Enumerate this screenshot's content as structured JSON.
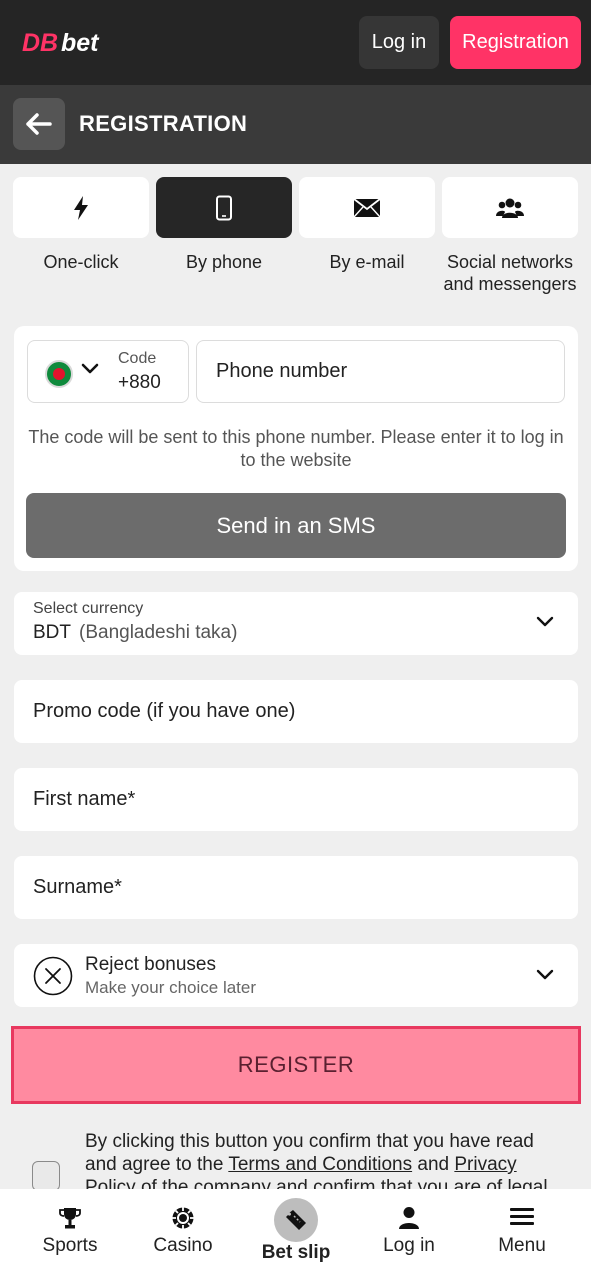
{
  "header": {
    "logo_text": "DBbet",
    "login_label": "Log in",
    "register_label": "Registration"
  },
  "titlebar": {
    "title": "REGISTRATION"
  },
  "methods": [
    {
      "label": "One-click",
      "icon": "lightning-icon",
      "active": false
    },
    {
      "label": "By phone",
      "icon": "phone-icon",
      "active": true
    },
    {
      "label": "By e-mail",
      "icon": "envelope-icon",
      "active": false
    },
    {
      "label": "Social networks and messengers",
      "icon": "users-icon",
      "active": false
    }
  ],
  "phone": {
    "code_label": "Code",
    "code_value": "+880",
    "number_placeholder": "Phone number",
    "hint": "The code will be sent to this phone number. Please enter it to log in to the website",
    "sms_button": "Send in an SMS"
  },
  "currency": {
    "label": "Select currency",
    "code": "BDT",
    "name": "(Bangladeshi taka)"
  },
  "fields": {
    "promo": "Promo code (if you have one)",
    "first_name": "First name*",
    "surname": "Surname*"
  },
  "bonus": {
    "title": "Reject bonuses",
    "subtitle": "Make your choice later"
  },
  "register_button": "REGISTER",
  "agreement": {
    "part1": "By clicking this button you confirm that you have read and agree to the ",
    "terms_link": "Terms and Conditions",
    "part2": " and ",
    "privacy_link": "Privacy Policy",
    "part3": " of the company and confirm that you are of legal"
  },
  "bottom_nav": [
    {
      "label": "Sports",
      "icon": "trophy-icon"
    },
    {
      "label": "Casino",
      "icon": "casino-chip-icon"
    },
    {
      "label": "Bet slip",
      "icon": "ticket-icon"
    },
    {
      "label": "Log in",
      "icon": "user-icon"
    },
    {
      "label": "Menu",
      "icon": "hamburger-menu-icon"
    }
  ],
  "colors": {
    "brand": "#ff3366",
    "header_bg": "#252525",
    "register_bg": "#ff8aa0"
  }
}
